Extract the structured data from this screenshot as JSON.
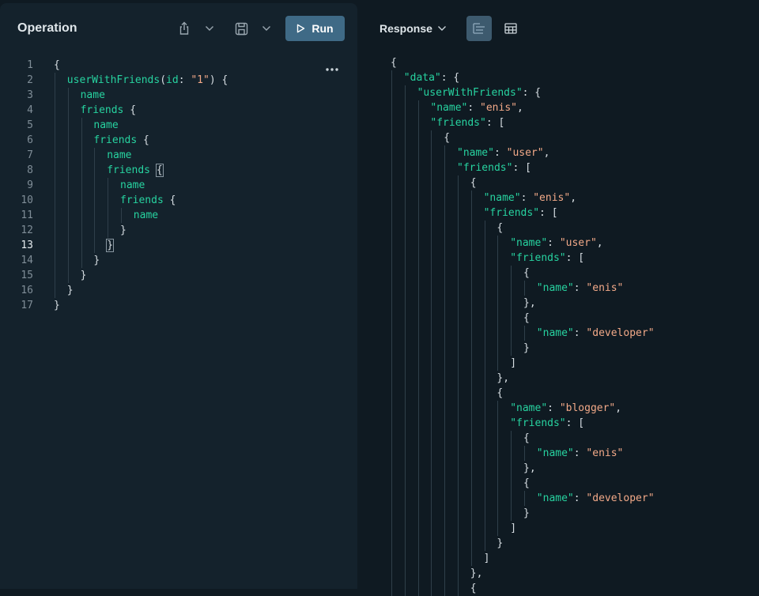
{
  "operation": {
    "title": "Operation",
    "run_label": "Run",
    "lines": [
      {
        "n": "1",
        "indent": 0,
        "tokens": [
          {
            "t": "p",
            "v": "{"
          }
        ]
      },
      {
        "n": "2",
        "indent": 1,
        "tokens": [
          {
            "t": "f",
            "v": "userWithFriends"
          },
          {
            "t": "p",
            "v": "("
          },
          {
            "t": "f",
            "v": "id"
          },
          {
            "t": "p",
            "v": ": "
          },
          {
            "t": "s",
            "v": "\"1\""
          },
          {
            "t": "p",
            "v": ") {"
          }
        ]
      },
      {
        "n": "3",
        "indent": 2,
        "tokens": [
          {
            "t": "f",
            "v": "name"
          }
        ]
      },
      {
        "n": "4",
        "indent": 2,
        "tokens": [
          {
            "t": "f",
            "v": "friends"
          },
          {
            "t": "p",
            "v": " {"
          }
        ]
      },
      {
        "n": "5",
        "indent": 3,
        "tokens": [
          {
            "t": "f",
            "v": "name"
          }
        ]
      },
      {
        "n": "6",
        "indent": 3,
        "tokens": [
          {
            "t": "f",
            "v": "friends"
          },
          {
            "t": "p",
            "v": " {"
          }
        ]
      },
      {
        "n": "7",
        "indent": 4,
        "tokens": [
          {
            "t": "f",
            "v": "name"
          }
        ]
      },
      {
        "n": "8",
        "indent": 4,
        "tokens": [
          {
            "t": "f",
            "v": "friends"
          },
          {
            "t": "p",
            "v": " "
          },
          {
            "t": "c",
            "v": "{"
          }
        ]
      },
      {
        "n": "9",
        "indent": 5,
        "tokens": [
          {
            "t": "f",
            "v": "name"
          }
        ]
      },
      {
        "n": "10",
        "indent": 5,
        "tokens": [
          {
            "t": "f",
            "v": "friends"
          },
          {
            "t": "p",
            "v": " {"
          }
        ]
      },
      {
        "n": "11",
        "indent": 6,
        "tokens": [
          {
            "t": "f",
            "v": "name"
          }
        ]
      },
      {
        "n": "12",
        "indent": 5,
        "tokens": [
          {
            "t": "p",
            "v": "}"
          }
        ]
      },
      {
        "n": "13",
        "indent": 4,
        "tokens": [
          {
            "t": "c",
            "v": "}"
          }
        ],
        "active": true
      },
      {
        "n": "14",
        "indent": 3,
        "tokens": [
          {
            "t": "p",
            "v": "}"
          }
        ]
      },
      {
        "n": "15",
        "indent": 2,
        "tokens": [
          {
            "t": "p",
            "v": "}"
          }
        ]
      },
      {
        "n": "16",
        "indent": 1,
        "tokens": [
          {
            "t": "p",
            "v": "}"
          }
        ]
      },
      {
        "n": "17",
        "indent": 0,
        "tokens": [
          {
            "t": "p",
            "v": "}"
          }
        ]
      }
    ]
  },
  "response": {
    "label": "Response",
    "lines": [
      {
        "indent": 0,
        "tokens": [
          {
            "t": "p",
            "v": "{"
          }
        ]
      },
      {
        "indent": 1,
        "tokens": [
          {
            "t": "f",
            "v": "\"data\""
          },
          {
            "t": "p",
            "v": ": {"
          }
        ]
      },
      {
        "indent": 2,
        "tokens": [
          {
            "t": "f",
            "v": "\"userWithFriends\""
          },
          {
            "t": "p",
            "v": ": {"
          }
        ]
      },
      {
        "indent": 3,
        "tokens": [
          {
            "t": "f",
            "v": "\"name\""
          },
          {
            "t": "p",
            "v": ": "
          },
          {
            "t": "s",
            "v": "\"enis\""
          },
          {
            "t": "p",
            "v": ","
          }
        ]
      },
      {
        "indent": 3,
        "tokens": [
          {
            "t": "f",
            "v": "\"friends\""
          },
          {
            "t": "p",
            "v": ": ["
          }
        ]
      },
      {
        "indent": 4,
        "tokens": [
          {
            "t": "p",
            "v": "{"
          }
        ]
      },
      {
        "indent": 5,
        "tokens": [
          {
            "t": "f",
            "v": "\"name\""
          },
          {
            "t": "p",
            "v": ": "
          },
          {
            "t": "s",
            "v": "\"user\""
          },
          {
            "t": "p",
            "v": ","
          }
        ]
      },
      {
        "indent": 5,
        "tokens": [
          {
            "t": "f",
            "v": "\"friends\""
          },
          {
            "t": "p",
            "v": ": ["
          }
        ]
      },
      {
        "indent": 6,
        "tokens": [
          {
            "t": "p",
            "v": "{"
          }
        ]
      },
      {
        "indent": 7,
        "tokens": [
          {
            "t": "f",
            "v": "\"name\""
          },
          {
            "t": "p",
            "v": ": "
          },
          {
            "t": "s",
            "v": "\"enis\""
          },
          {
            "t": "p",
            "v": ","
          }
        ]
      },
      {
        "indent": 7,
        "tokens": [
          {
            "t": "f",
            "v": "\"friends\""
          },
          {
            "t": "p",
            "v": ": ["
          }
        ]
      },
      {
        "indent": 8,
        "tokens": [
          {
            "t": "p",
            "v": "{"
          }
        ]
      },
      {
        "indent": 9,
        "tokens": [
          {
            "t": "f",
            "v": "\"name\""
          },
          {
            "t": "p",
            "v": ": "
          },
          {
            "t": "s",
            "v": "\"user\""
          },
          {
            "t": "p",
            "v": ","
          }
        ]
      },
      {
        "indent": 9,
        "tokens": [
          {
            "t": "f",
            "v": "\"friends\""
          },
          {
            "t": "p",
            "v": ": ["
          }
        ]
      },
      {
        "indent": 10,
        "tokens": [
          {
            "t": "p",
            "v": "{"
          }
        ]
      },
      {
        "indent": 11,
        "tokens": [
          {
            "t": "f",
            "v": "\"name\""
          },
          {
            "t": "p",
            "v": ": "
          },
          {
            "t": "s",
            "v": "\"enis\""
          }
        ]
      },
      {
        "indent": 10,
        "tokens": [
          {
            "t": "p",
            "v": "},"
          }
        ]
      },
      {
        "indent": 10,
        "tokens": [
          {
            "t": "p",
            "v": "{"
          }
        ]
      },
      {
        "indent": 11,
        "tokens": [
          {
            "t": "f",
            "v": "\"name\""
          },
          {
            "t": "p",
            "v": ": "
          },
          {
            "t": "s",
            "v": "\"developer\""
          }
        ]
      },
      {
        "indent": 10,
        "tokens": [
          {
            "t": "p",
            "v": "}"
          }
        ]
      },
      {
        "indent": 9,
        "tokens": [
          {
            "t": "p",
            "v": "]"
          }
        ]
      },
      {
        "indent": 8,
        "tokens": [
          {
            "t": "p",
            "v": "},"
          }
        ]
      },
      {
        "indent": 8,
        "tokens": [
          {
            "t": "p",
            "v": "{"
          }
        ]
      },
      {
        "indent": 9,
        "tokens": [
          {
            "t": "f",
            "v": "\"name\""
          },
          {
            "t": "p",
            "v": ": "
          },
          {
            "t": "s",
            "v": "\"blogger\""
          },
          {
            "t": "p",
            "v": ","
          }
        ]
      },
      {
        "indent": 9,
        "tokens": [
          {
            "t": "f",
            "v": "\"friends\""
          },
          {
            "t": "p",
            "v": ": ["
          }
        ]
      },
      {
        "indent": 10,
        "tokens": [
          {
            "t": "p",
            "v": "{"
          }
        ]
      },
      {
        "indent": 11,
        "tokens": [
          {
            "t": "f",
            "v": "\"name\""
          },
          {
            "t": "p",
            "v": ": "
          },
          {
            "t": "s",
            "v": "\"enis\""
          }
        ]
      },
      {
        "indent": 10,
        "tokens": [
          {
            "t": "p",
            "v": "},"
          }
        ]
      },
      {
        "indent": 10,
        "tokens": [
          {
            "t": "p",
            "v": "{"
          }
        ]
      },
      {
        "indent": 11,
        "tokens": [
          {
            "t": "f",
            "v": "\"name\""
          },
          {
            "t": "p",
            "v": ": "
          },
          {
            "t": "s",
            "v": "\"developer\""
          }
        ]
      },
      {
        "indent": 10,
        "tokens": [
          {
            "t": "p",
            "v": "}"
          }
        ]
      },
      {
        "indent": 9,
        "tokens": [
          {
            "t": "p",
            "v": "]"
          }
        ]
      },
      {
        "indent": 8,
        "tokens": [
          {
            "t": "p",
            "v": "}"
          }
        ]
      },
      {
        "indent": 7,
        "tokens": [
          {
            "t": "p",
            "v": "]"
          }
        ]
      },
      {
        "indent": 6,
        "tokens": [
          {
            "t": "p",
            "v": "},"
          }
        ]
      },
      {
        "indent": 6,
        "tokens": [
          {
            "t": "p",
            "v": "{"
          }
        ]
      }
    ]
  },
  "colors": {
    "field": "#27d3a0",
    "string": "#f2a988",
    "run_button": "#3f6a86"
  },
  "icons": [
    "share-icon",
    "chevron-down-icon",
    "save-icon",
    "play-icon",
    "more-icon",
    "tree-view-icon",
    "table-view-icon"
  ]
}
